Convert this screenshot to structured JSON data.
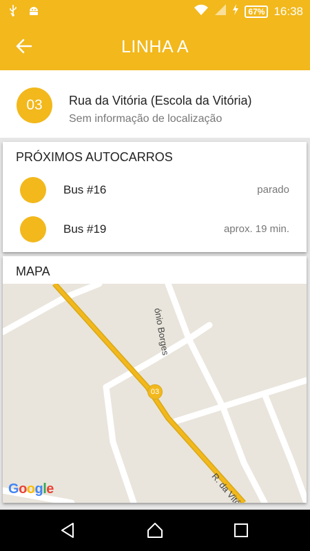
{
  "status": {
    "time": "16:38",
    "battery": "67%",
    "left_icons": [
      "usb-icon",
      "android-icon"
    ],
    "right_icons": [
      "wifi-icon",
      "signal-icon",
      "charging-icon",
      "battery-icon"
    ]
  },
  "appbar": {
    "title": "LINHA A",
    "back_icon": "arrow-back-icon"
  },
  "stop": {
    "number": "03",
    "name": "Rua da Vitória (Escola da Vitória)",
    "location_info": "Sem informação de localização"
  },
  "buses_section": {
    "title": "PRÓXIMOS AUTOCARROS",
    "items": [
      {
        "name": "Bus #16",
        "status": "parado"
      },
      {
        "name": "Bus #19",
        "status": "aprox. 19 min."
      }
    ]
  },
  "map_section": {
    "title": "MAPA",
    "street_label_1": "ónio Borges",
    "street_label_2": "R. da Vitória",
    "stop_marker": "03",
    "attribution": "Google"
  },
  "colors": {
    "accent": "#f2b81c",
    "map_bg": "#e9e5dc",
    "road": "#ffffff",
    "route": "#f2b81c"
  },
  "navbar": {
    "icons": [
      "back-triangle-icon",
      "home-icon",
      "recents-icon"
    ]
  }
}
